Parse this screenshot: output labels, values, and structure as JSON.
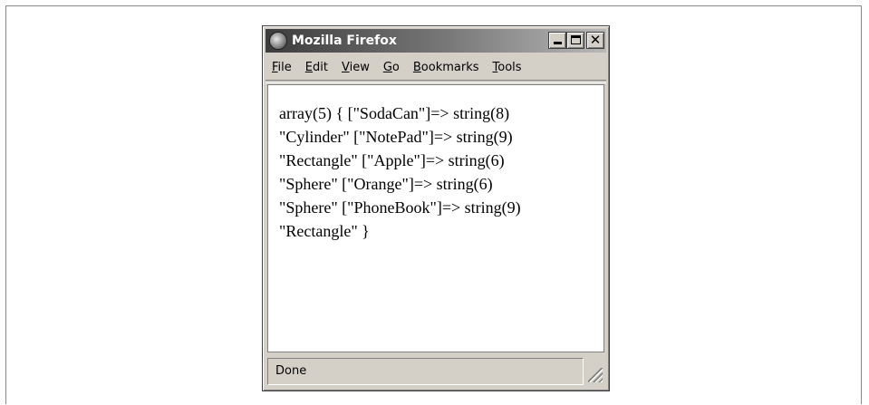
{
  "window": {
    "title": "Mozilla Firefox",
    "controls": {
      "minimize": "_",
      "maximize": "□",
      "close": "✕"
    }
  },
  "menu": [
    {
      "ul": "F",
      "rest": "ile"
    },
    {
      "ul": "E",
      "rest": "dit"
    },
    {
      "ul": "V",
      "rest": "iew"
    },
    {
      "ul": "G",
      "rest": "o"
    },
    {
      "ul": "B",
      "rest": "ookmarks"
    },
    {
      "ul": "T",
      "rest": "ools"
    }
  ],
  "content": {
    "lines": [
      "array(5) { [\"SodaCan\"]=> string(8)",
      "\"Cylinder\" [\"NotePad\"]=> string(9)",
      "\"Rectangle\" [\"Apple\"]=> string(6)",
      "\"Sphere\" [\"Orange\"]=> string(6)",
      "\"Sphere\" [\"PhoneBook\"]=> string(9)",
      "\"Rectangle\" }"
    ]
  },
  "status": {
    "text": "Done"
  },
  "colors": {
    "chrome": "#d4d0c8",
    "titlebar_start": "#3c3c3c",
    "titlebar_end": "#b8b8b8",
    "content_bg": "#ffffff"
  }
}
